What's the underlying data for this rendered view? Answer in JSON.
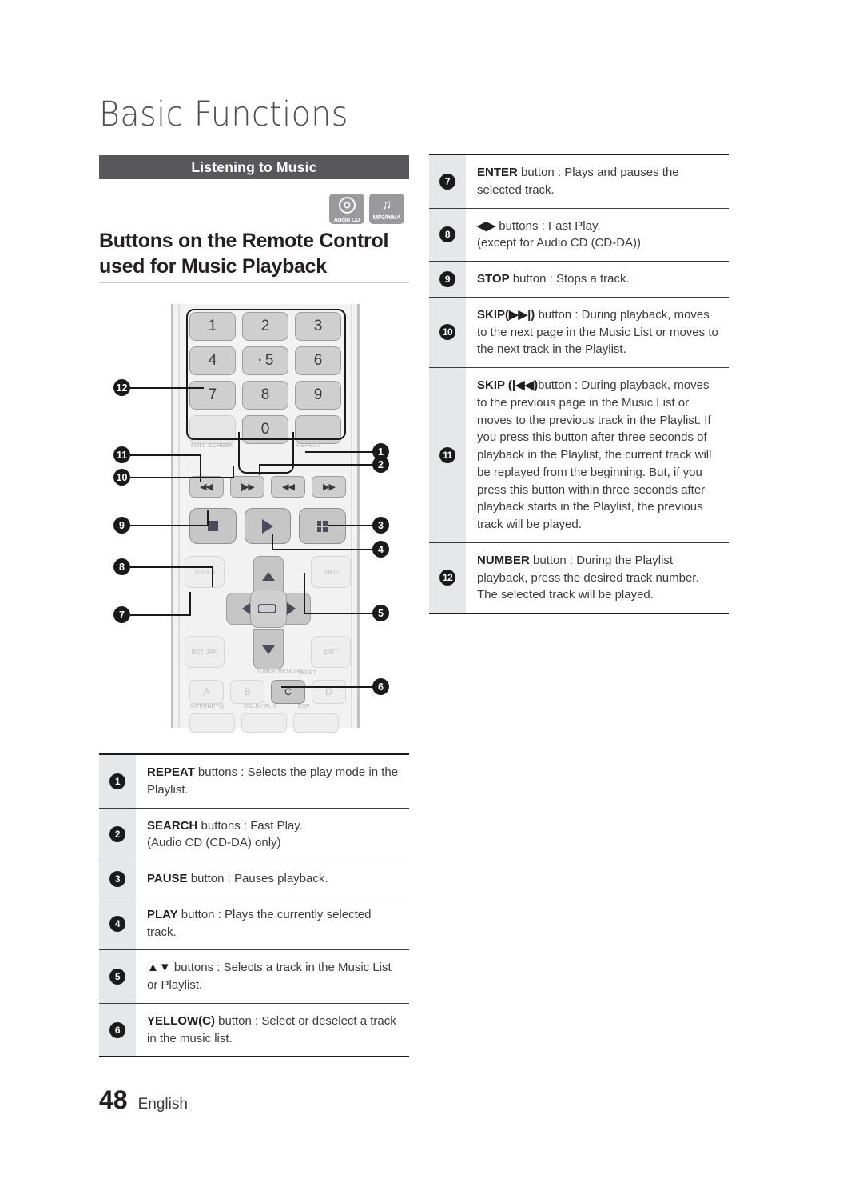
{
  "chapter": {
    "title": "Basic Functions"
  },
  "section": {
    "bar_label": "Listening to Music"
  },
  "badges": [
    {
      "name": "audio-cd",
      "label": "Audio CD"
    },
    {
      "name": "mp3-wma",
      "label": "MP3/WMA",
      "glyph": "♫"
    }
  ],
  "heading": {
    "text": "Buttons on the Remote Control used for Music Playback"
  },
  "remote": {
    "keys": [
      {
        "label": "1"
      },
      {
        "label": "2"
      },
      {
        "label": "3"
      },
      {
        "label": "4"
      },
      {
        "label": "5"
      },
      {
        "label": "6"
      },
      {
        "label": "7"
      },
      {
        "label": "8"
      },
      {
        "label": "9"
      },
      {
        "label": "0"
      }
    ],
    "labels": {
      "full_screen": "FULL SCREEN",
      "repeat": "REPEAT",
      "tools": "TOOLS",
      "info": "INFO",
      "return": "RETURN",
      "exit": "EXIT",
      "tuner_memory": "TUNER MEMORY",
      "most": "MO/ST",
      "internet": "INTERNET@",
      "dolby": "DOLBY PL II",
      "dsp": "DSP"
    },
    "color_keys": [
      {
        "label": "A"
      },
      {
        "label": "B"
      },
      {
        "label": "C"
      },
      {
        "label": "D"
      }
    ],
    "transport": [
      {
        "name": "skip-back",
        "glyph": "◀◀|"
      },
      {
        "name": "skip-forward",
        "glyph": "|▶▶"
      },
      {
        "name": "search-back",
        "glyph": "◀◀"
      },
      {
        "name": "search-forward",
        "glyph": "▶▶"
      }
    ],
    "callouts_left": [
      "12",
      "11",
      "10",
      "9",
      "8",
      "7"
    ],
    "callouts_right": [
      "1",
      "2",
      "3",
      "4",
      "5",
      "6"
    ]
  },
  "table_right": {
    "rows": [
      {
        "num": "7",
        "strong": "ENTER",
        "text": " button : Plays and pauses the selected track."
      },
      {
        "num": "8",
        "strong": "◀▶",
        "text": " buttons : Fast Play.\n(except for Audio CD (CD-DA))"
      },
      {
        "num": "9",
        "strong": "STOP",
        "text": " button : Stops a track."
      },
      {
        "num": "10",
        "strong": "SKIP(▶▶|)",
        "text": " button : During playback, moves to the next page in the Music List or moves to the next track in the Playlist."
      },
      {
        "num": "11",
        "strong": "SKIP (|◀◀)",
        "text": "button : During playback, moves to the previous page in the Music List or moves to the previous track in the Playlist. If you press this button after three seconds of playback in the Playlist, the current track will be replayed from the beginning. But, if you press this button within three seconds after playback starts in the Playlist, the previous track will be played."
      },
      {
        "num": "12",
        "strong": "NUMBER",
        "text": " button : During the Playlist playback, press the desired track number. The selected track will be played."
      }
    ]
  },
  "table_left": {
    "rows": [
      {
        "num": "1",
        "strong": "REPEAT",
        "text": " buttons : Selects the play mode in the Playlist."
      },
      {
        "num": "2",
        "strong": "SEARCH",
        "text": " buttons : Fast Play.\n(Audio CD (CD-DA) only)"
      },
      {
        "num": "3",
        "strong": "PAUSE",
        "text": " button : Pauses playback."
      },
      {
        "num": "4",
        "strong": "PLAY",
        "text": " button : Plays the currently selected track."
      },
      {
        "num": "5",
        "strong": "▲▼",
        "text": " buttons : Selects a track in the Music List or Playlist."
      },
      {
        "num": "6",
        "strong": "YELLOW(C)",
        "text": " button : Select or deselect a track in the music list."
      }
    ]
  },
  "footer": {
    "page_number": "48",
    "language": "English"
  }
}
